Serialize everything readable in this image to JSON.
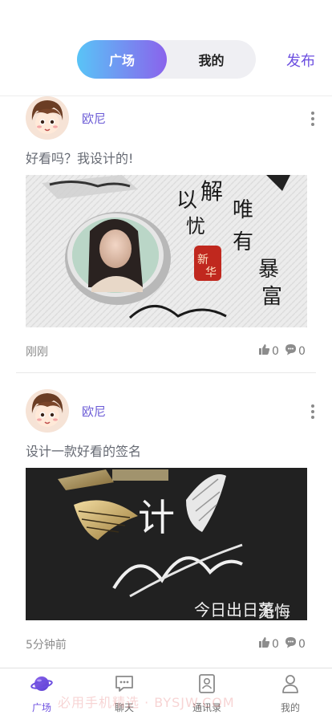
{
  "header": {
    "segment_active": "广场",
    "segment_inactive": "我的",
    "publish_label": "发布"
  },
  "posts": [
    {
      "username": "欧尼",
      "text": "好看吗？我设计的!",
      "time": "刚刚",
      "likes": "0",
      "comments": "0"
    },
    {
      "username": "欧尼",
      "text": "设计一款好看的签名",
      "time": "5分钟前",
      "likes": "0",
      "comments": "0"
    }
  ],
  "tabbar": {
    "items": [
      {
        "label": "广场",
        "icon": "planet-icon",
        "active": true
      },
      {
        "label": "聊天",
        "icon": "chat-icon",
        "active": false
      },
      {
        "label": "通讯录",
        "icon": "contacts-icon",
        "active": false
      },
      {
        "label": "我的",
        "icon": "person-icon",
        "active": false
      }
    ]
  },
  "watermark": "必用手机精选 · BYSJW.COM",
  "colors": {
    "accent": "#6c4fe0",
    "gradient_start": "#59c4f7",
    "gradient_end": "#8a63ec"
  }
}
